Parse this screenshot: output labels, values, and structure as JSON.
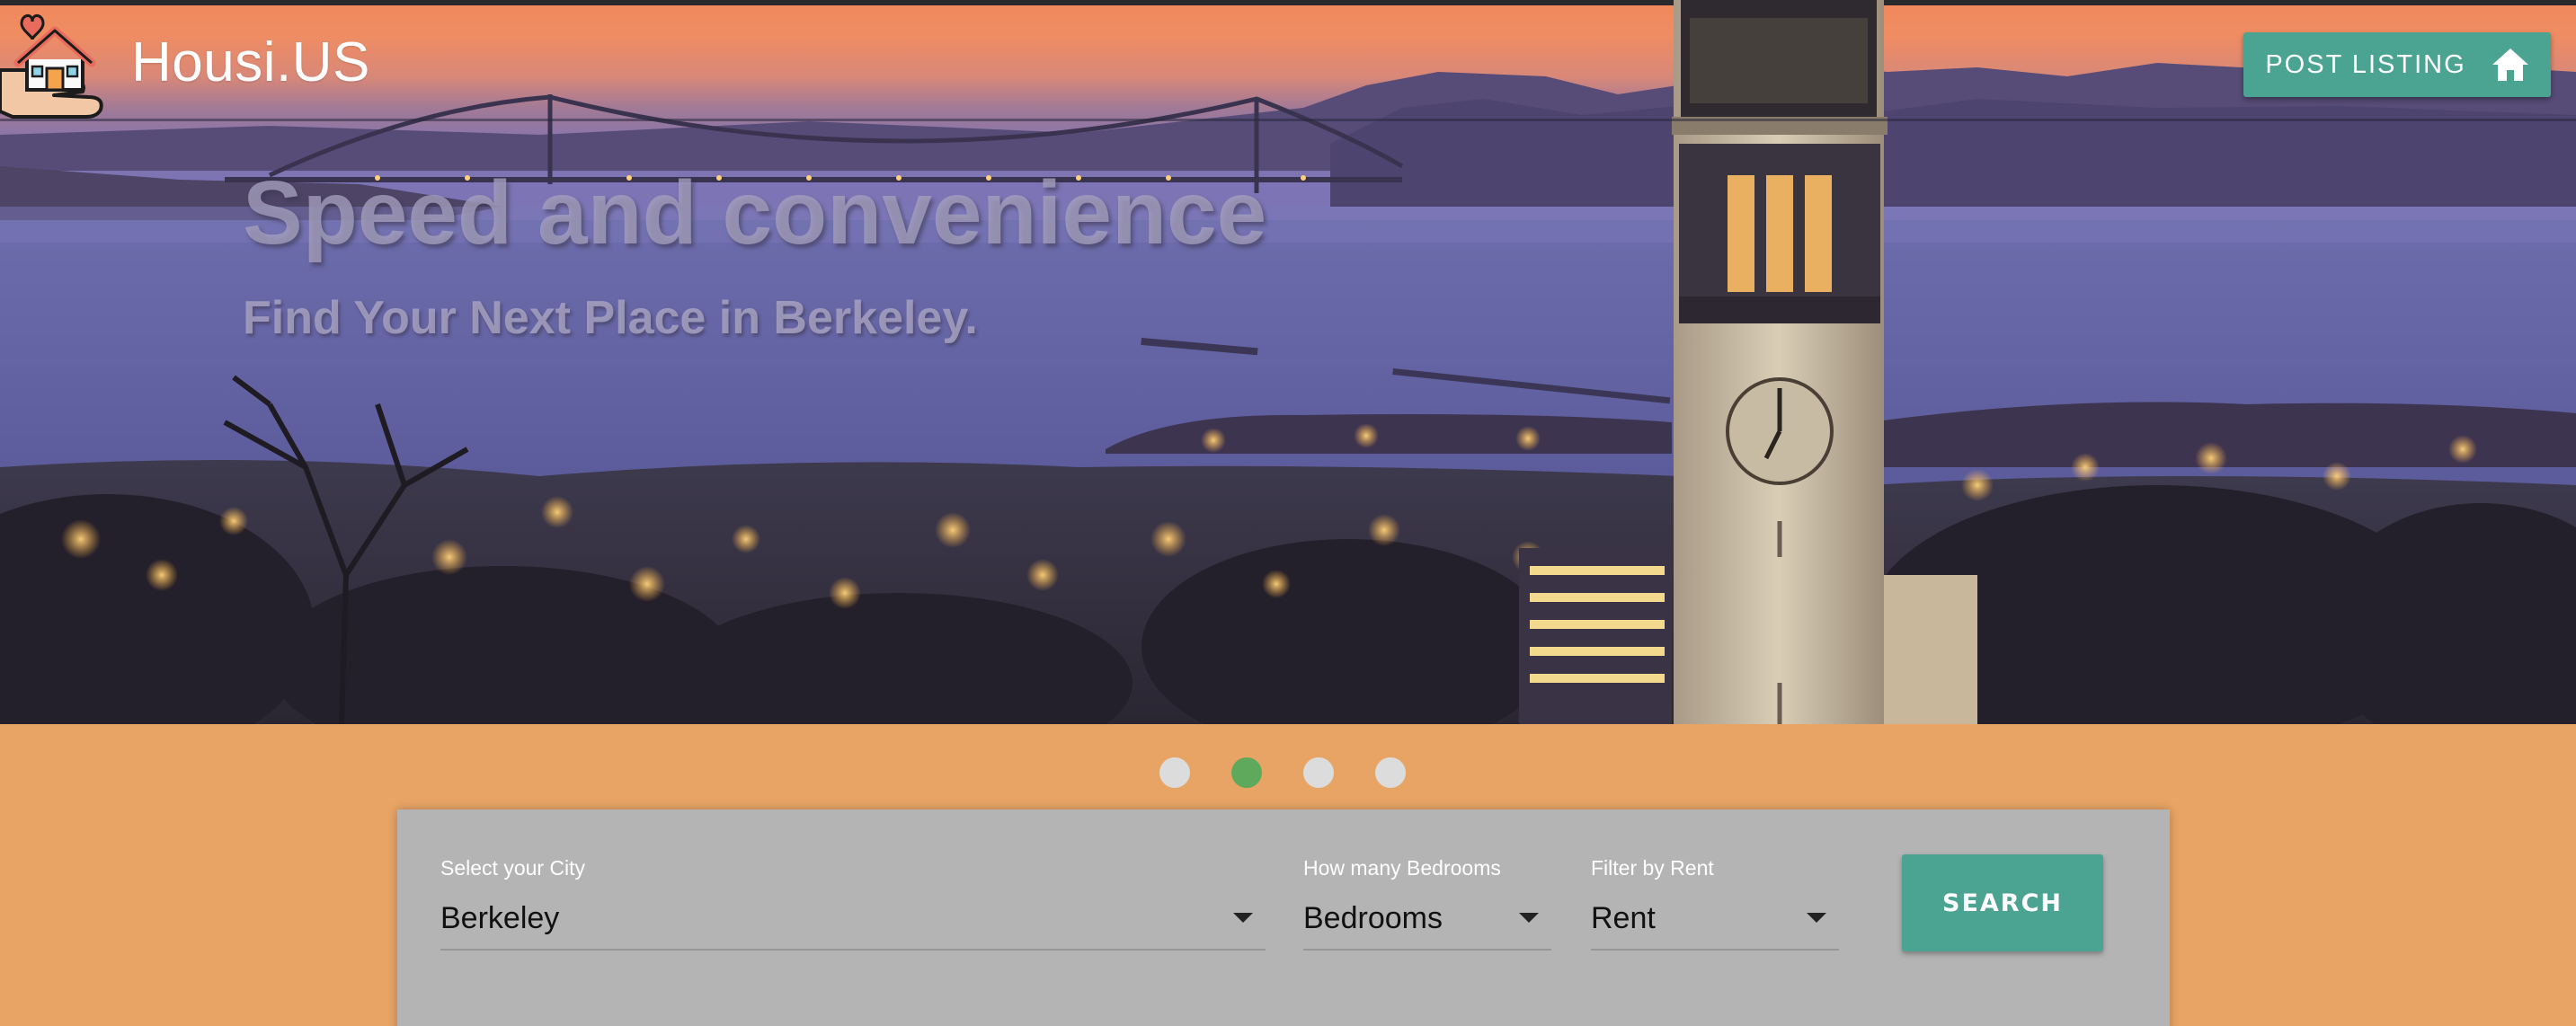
{
  "brand": {
    "name": "Housi.US",
    "logo_icon": "house-heart-hand-icon"
  },
  "header": {
    "post_listing_label": "POST LISTING",
    "post_listing_icon": "home-icon"
  },
  "hero": {
    "headline": "Speed and convenience",
    "subheadline": "Find Your Next Place in Berkeley."
  },
  "carousel": {
    "slide_count": 4,
    "active_index": 1
  },
  "search": {
    "city": {
      "label": "Select your City",
      "value": "Berkeley"
    },
    "bedrooms": {
      "label": "How many Bedrooms",
      "value": "Bedrooms"
    },
    "rent": {
      "label": "Filter by Rent",
      "value": "Rent"
    },
    "button_label": "SEARCH"
  },
  "colors": {
    "page_background": "#e8a465",
    "accent_teal": "#4ba392",
    "active_dot": "#5fa95c",
    "inactive_dot": "#dcdcdc",
    "search_panel": "#b4b4b4"
  }
}
